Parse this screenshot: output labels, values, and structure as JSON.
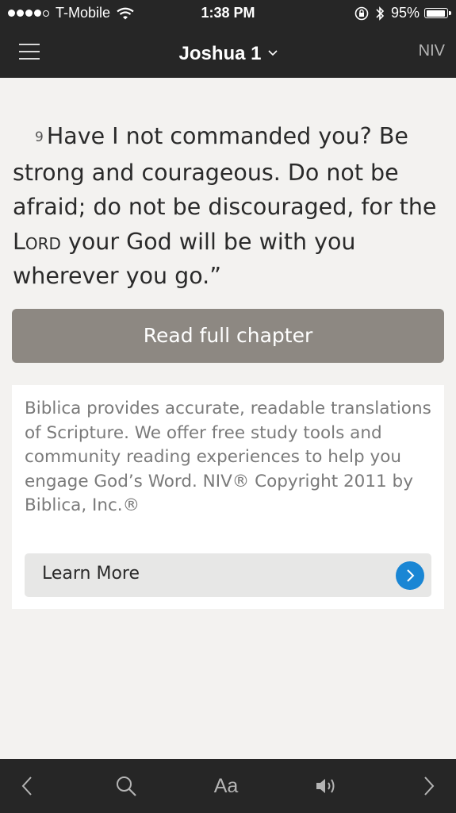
{
  "status_bar": {
    "carrier": "T-Mobile",
    "time": "1:38 PM",
    "battery": "95%"
  },
  "header": {
    "title": "Joshua 1",
    "version": "NIV"
  },
  "verse": {
    "number": "9",
    "text_part1": "Have I not commanded you? Be strong and courageous. Do not be afraid; do not be discouraged, for the ",
    "lord": "Lord",
    "text_part2": " your God will be with you wherever you go.”"
  },
  "read_button": "Read full chapter",
  "publisher_card": {
    "description": "Biblica provides accurate, readable translations of Scripture. We offer free study tools and community reading experiences to help you engage God’s Word. NIV® Copyright 2011 by Biblica, Inc.®",
    "learn_more": "Learn More"
  },
  "toolbar": {
    "font_label": "Aa"
  },
  "colors": {
    "bar": "#262626",
    "background": "#f3f2f0",
    "read_button": "#8d8882",
    "accent": "#1a86d4"
  },
  "icons": [
    "hamburger-icon",
    "chevron-down-icon",
    "wifi-icon",
    "lock-rotation-icon",
    "bluetooth-icon",
    "battery-icon",
    "back-icon",
    "search-icon",
    "speaker-icon",
    "forward-icon",
    "chevron-right-icon"
  ]
}
